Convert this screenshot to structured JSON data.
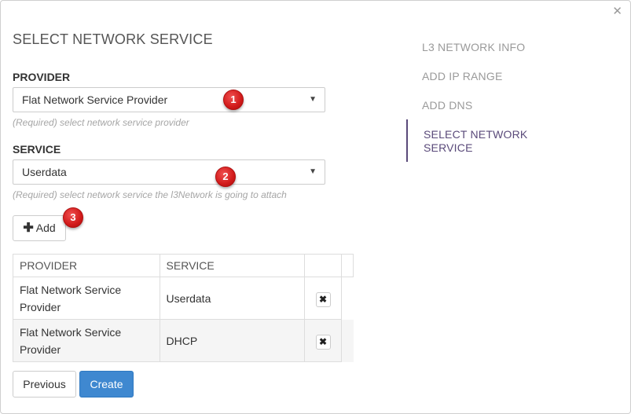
{
  "dialog": {
    "title": "SELECT NETWORK SERVICE",
    "close_icon": "close-icon"
  },
  "provider": {
    "label": "PROVIDER",
    "value": "Flat Network Service Provider",
    "help": "(Required) select network service provider"
  },
  "service": {
    "label": "SERVICE",
    "value": "Userdata",
    "help": "(Required) select network service the l3Network is going to attach"
  },
  "markers": [
    "1",
    "2",
    "3"
  ],
  "add_button": {
    "icon": "plus-icon",
    "label": "Add"
  },
  "table": {
    "headers": [
      "PROVIDER",
      "SERVICE",
      ""
    ],
    "rows": [
      {
        "provider": "Flat Network Service Provider",
        "service": "Userdata"
      },
      {
        "provider": "Flat Network Service Provider",
        "service": "DHCP"
      }
    ]
  },
  "footer": {
    "previous_label": "Previous",
    "create_label": "Create"
  },
  "steps": [
    {
      "label": "L3 NETWORK INFO",
      "active": false
    },
    {
      "label": "ADD IP RANGE",
      "active": false
    },
    {
      "label": "ADD DNS",
      "active": false
    },
    {
      "label": "SELECT NETWORK SERVICE",
      "active": true
    }
  ],
  "colors": {
    "primary": "#3f88d0",
    "active_step": "#5a4a7a",
    "marker": "#d11a1a"
  }
}
